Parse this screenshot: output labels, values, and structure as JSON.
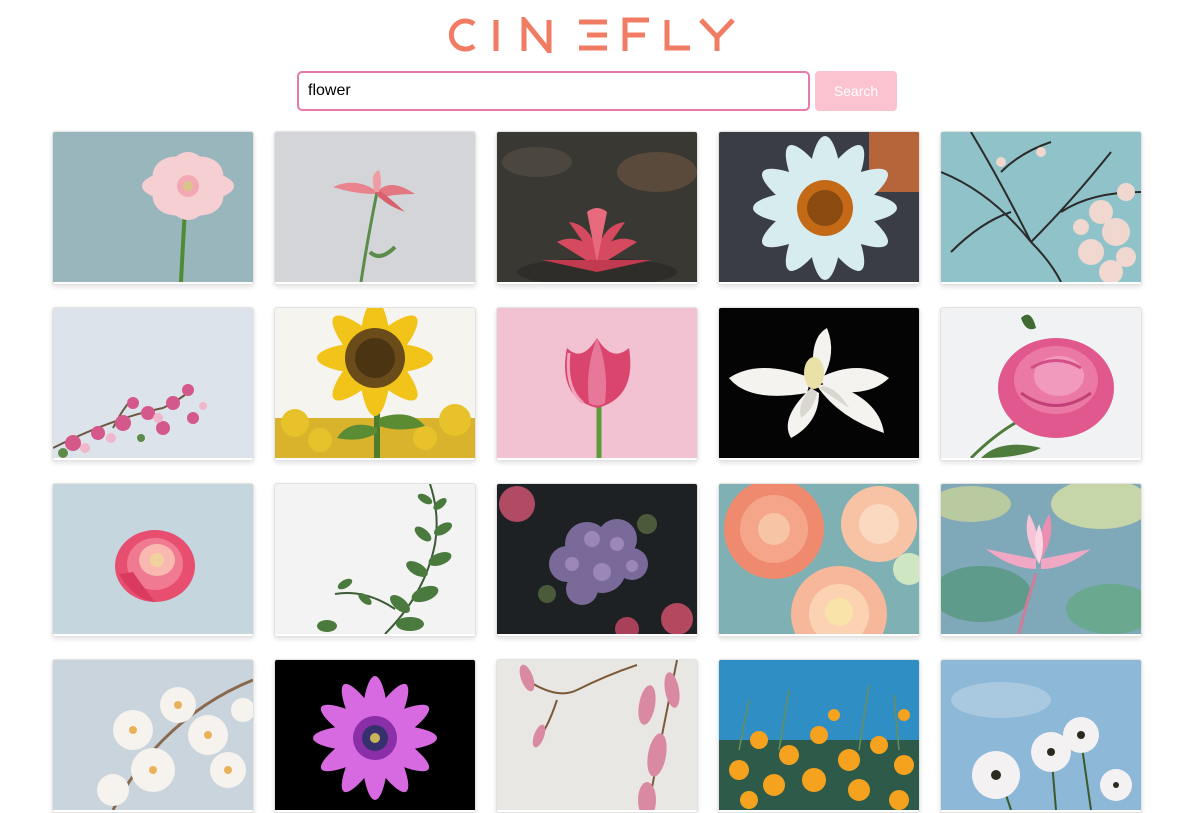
{
  "app": {
    "logo_text": "CINEFLY",
    "brand_color": "#f07c63"
  },
  "search": {
    "value": "flower",
    "button_label": "Search",
    "input_border_color": "#e879a8",
    "button_color": "#fbc2d0"
  },
  "photos": [
    "pink-gerbera-daisy",
    "pink-lily-on-gray",
    "red-water-lily",
    "white-daisy-orange-center",
    "cherry-blossom-branches",
    "pink-flower-cluster",
    "sunflower-field",
    "pink-tulip",
    "white-magnolia-black",
    "pink-peony",
    "pink-rose-on-blue-gray",
    "eucalyptus-sprig",
    "purple-hydrangea",
    "peach-dahlias",
    "pink-lotus-on-water",
    "white-cherry-blossoms",
    "magenta-daisy-black",
    "magnolia-buds",
    "orange-poppies-blue-sky",
    "white-cosmos-sky"
  ]
}
